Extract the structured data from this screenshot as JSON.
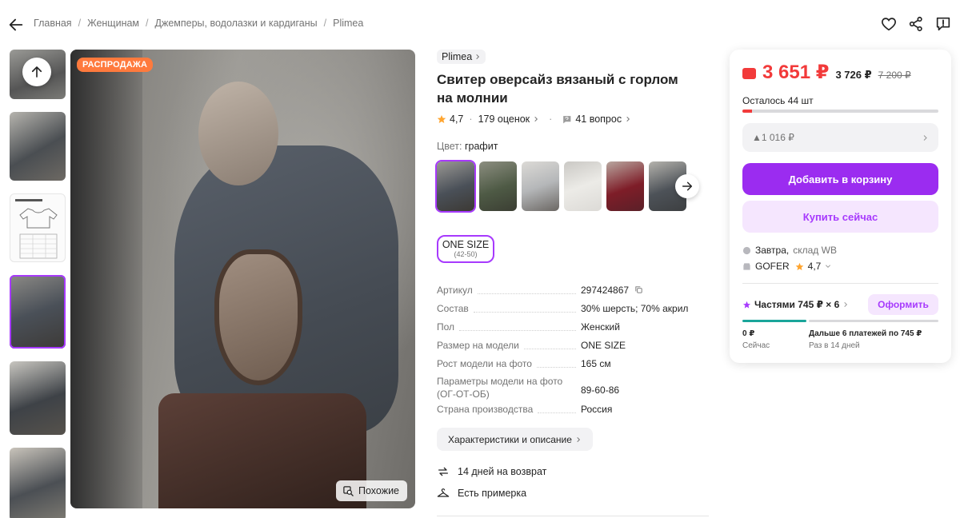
{
  "breadcrumbs": [
    "Главная",
    "Женщинам",
    "Джемперы, водолазки и кардиганы",
    "Plimea"
  ],
  "photo": {
    "badge": "РАСПРОДАЖА",
    "similar_label": "Похожие"
  },
  "product": {
    "brand": "Plimea",
    "title": "Свитер оверсайз вязаный с горлом на молнии",
    "rating": "4,7",
    "reviews": "179 оценок",
    "questions": "41 вопрос",
    "color_label": "Цвет:",
    "color_value": "графит",
    "size": "ONE SIZE",
    "size_range": "(42-50)"
  },
  "specs": [
    {
      "key": "Артикул",
      "value": "297424867"
    },
    {
      "key": "Состав",
      "value": "30% шерсть; 70% акрил"
    },
    {
      "key": "Пол",
      "value": "Женский"
    },
    {
      "key": "Размер на модели",
      "value": "ONE SIZE"
    },
    {
      "key": "Рост модели на фото",
      "value": "165 см"
    },
    {
      "key": "Параметры модели на фото",
      "key2": "(ОГ-ОТ-ОБ)",
      "value": "89-60-86"
    },
    {
      "key": "Страна производства",
      "value": "Россия"
    }
  ],
  "characteristics_button": "Характеристики и описание",
  "perks": [
    "14 дней на возврат",
    "Есть примерка"
  ],
  "card": {
    "price": "3 651 ₽",
    "price_old1": "3 726 ₽",
    "price_old2": "7 200 ₽",
    "stock_text": "Осталось 44 шт",
    "stock_fraction": 0.05,
    "discount_text": "▲1 016 ₽",
    "add_to_cart": "Добавить в корзину",
    "buy_now": "Купить сейчас",
    "delivery_day": "Завтра,",
    "delivery_where": "склад WB",
    "seller_name": "GOFER",
    "seller_rating": "4,7",
    "installments": "Частями 745 ₽ × 6",
    "order_button": "Оформить",
    "pay_now_amount": "0 ₽",
    "pay_now_label": "Сейчас",
    "pay_later_amount": "Дальше 6 платежей по 745 ₽",
    "pay_later_label": "Раз в 14 дней"
  },
  "colors": {
    "accent": "#a73afd",
    "price": "#f23a3a",
    "cart_button": "#9b2cf0",
    "installment": "#1aa59a"
  },
  "icons": [
    "arrow-left-icon",
    "heart-icon",
    "share-icon",
    "report-icon",
    "arrow-up-icon",
    "zoom-search-icon",
    "star-icon",
    "question-icon",
    "chevron-right-icon",
    "copy-icon",
    "return-icon",
    "hanger-icon",
    "wallet-icon",
    "truck-icon",
    "shop-icon",
    "installment-icon"
  ]
}
